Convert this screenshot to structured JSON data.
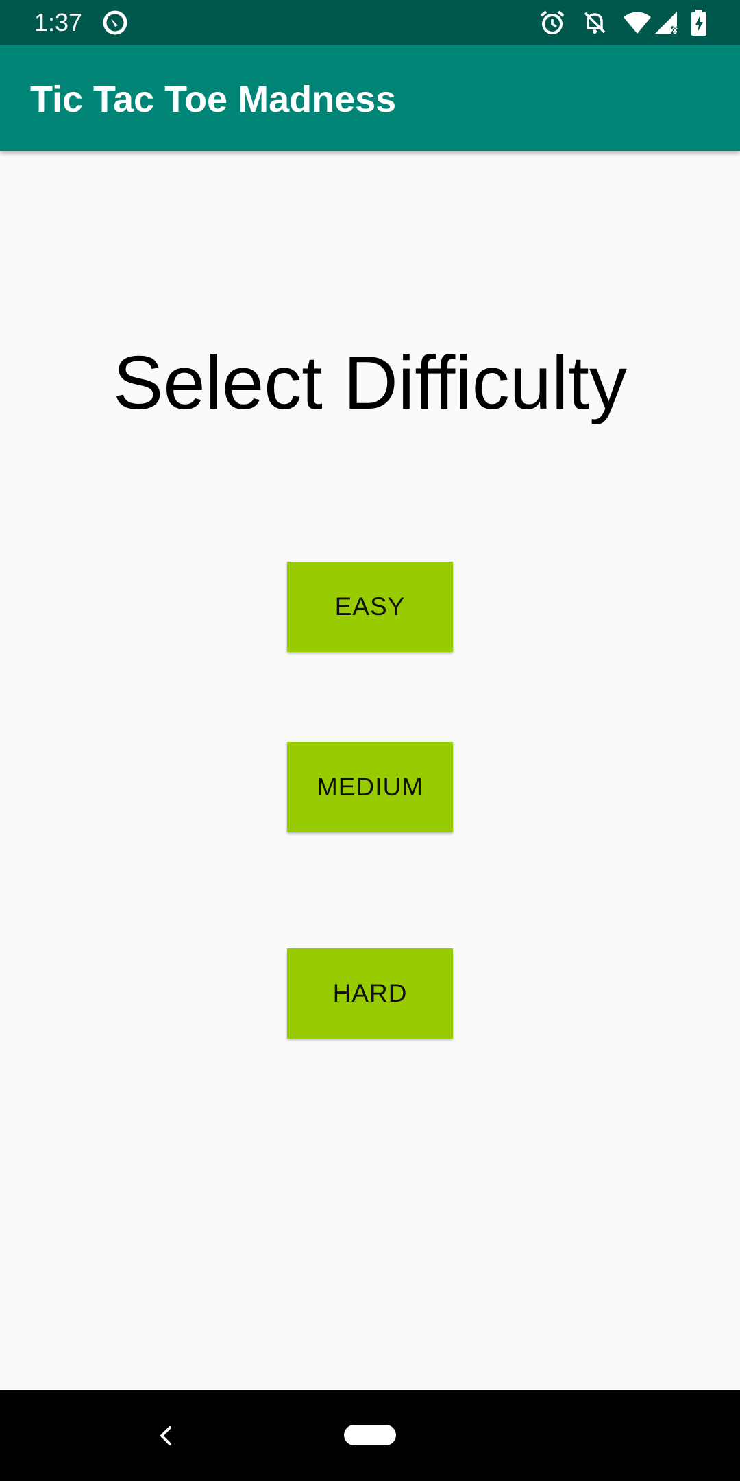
{
  "status_bar": {
    "time": "1:37",
    "icons": [
      "sync-icon",
      "alarm-icon",
      "notifications-off-icon",
      "wifi-icon",
      "signal-icon",
      "battery-charging-icon"
    ]
  },
  "app_bar": {
    "title": "Tic Tac Toe Madness"
  },
  "main": {
    "heading": "Select Difficulty",
    "buttons": [
      {
        "label": "EASY"
      },
      {
        "label": "MEDIUM"
      },
      {
        "label": "HARD"
      }
    ]
  },
  "nav_bar": {
    "icons": [
      "back-icon",
      "home-pill-icon"
    ]
  },
  "colors": {
    "status_bar": "#00574b",
    "app_bar": "#008577",
    "button": "#99cc00",
    "background": "#fafafa"
  }
}
